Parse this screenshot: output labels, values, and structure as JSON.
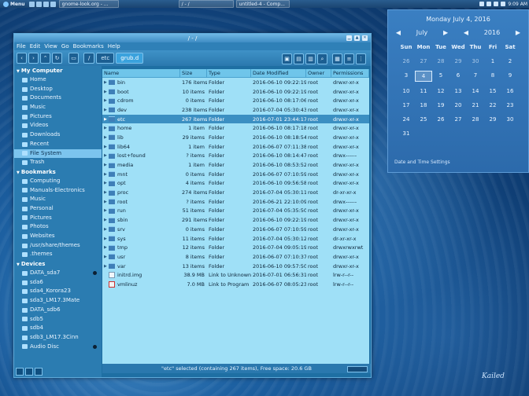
{
  "panel": {
    "menu_label": "Menu",
    "tasks": [
      "gnome-look.org - ...",
      "/ - /",
      "untitled-4 - Comp..."
    ],
    "clock": "9:09 AM"
  },
  "calendar": {
    "date_title": "Monday July  4, 2016",
    "month": "July",
    "year": "2016",
    "prev_arrow": "◀",
    "next_arrow": "▶",
    "weekdays": [
      "Sun",
      "Mon",
      "Tue",
      "Wed",
      "Thu",
      "Fri",
      "Sat"
    ],
    "weeks": [
      [
        "26",
        "27",
        "28",
        "29",
        "30",
        "1",
        "2"
      ],
      [
        "3",
        "4",
        "5",
        "6",
        "7",
        "8",
        "9"
      ],
      [
        "10",
        "11",
        "12",
        "13",
        "14",
        "15",
        "16"
      ],
      [
        "17",
        "18",
        "19",
        "20",
        "21",
        "22",
        "23"
      ],
      [
        "24",
        "25",
        "26",
        "27",
        "28",
        "29",
        "30"
      ],
      [
        "31",
        "",
        "",
        "",
        "",
        "",
        ""
      ]
    ],
    "today": "4",
    "footer": "Date and Time Settings"
  },
  "window": {
    "title": "/ - /",
    "menu": [
      "File",
      "Edit",
      "View",
      "Go",
      "Bookmarks",
      "Help"
    ],
    "breadcrumbs": [
      "/",
      "etc",
      "grub.d"
    ],
    "columns": {
      "name": "Name",
      "size": "Size",
      "type": "Type",
      "modified": "Date Modified",
      "owner": "Owner",
      "perms": "Permissions"
    },
    "files": [
      {
        "name": "bin",
        "size": "176 items",
        "type": "Folder",
        "modified": "2016-06-10 09:22:19",
        "owner": "root",
        "perms": "drwxr-xr-x",
        "icon": "folder"
      },
      {
        "name": "boot",
        "size": "10 items",
        "type": "Folder",
        "modified": "2016-06-10 09:22:19",
        "owner": "root",
        "perms": "drwxr-xr-x",
        "icon": "folder"
      },
      {
        "name": "cdrom",
        "size": "0 items",
        "type": "Folder",
        "modified": "2016-06-10 08:17:06",
        "owner": "root",
        "perms": "drwxr-xr-x",
        "icon": "folder"
      },
      {
        "name": "dev",
        "size": "238 items",
        "type": "Folder",
        "modified": "2016-07-04 05:30:43",
        "owner": "root",
        "perms": "drwxr-xr-x",
        "icon": "folder"
      },
      {
        "name": "etc",
        "size": "267 items",
        "type": "Folder",
        "modified": "2016-07-01 23:44:17",
        "owner": "root",
        "perms": "drwxr-xr-x",
        "icon": "folder",
        "selected": true
      },
      {
        "name": "home",
        "size": "1 item",
        "type": "Folder",
        "modified": "2016-06-10 08:17:18",
        "owner": "root",
        "perms": "drwxr-xr-x",
        "icon": "folder"
      },
      {
        "name": "lib",
        "size": "29 items",
        "type": "Folder",
        "modified": "2016-06-10 08:18:54",
        "owner": "root",
        "perms": "drwxr-xr-x",
        "icon": "folder"
      },
      {
        "name": "lib64",
        "size": "1 item",
        "type": "Folder",
        "modified": "2016-06-07 07:11:38",
        "owner": "root",
        "perms": "drwxr-xr-x",
        "icon": "folder"
      },
      {
        "name": "lost+found",
        "size": "? items",
        "type": "Folder",
        "modified": "2016-06-10 08:14:47",
        "owner": "root",
        "perms": "drwx------",
        "icon": "folder"
      },
      {
        "name": "media",
        "size": "1 item",
        "type": "Folder",
        "modified": "2016-06-10 08:53:52",
        "owner": "root",
        "perms": "drwxr-xr-x",
        "icon": "folder"
      },
      {
        "name": "mnt",
        "size": "0 items",
        "type": "Folder",
        "modified": "2016-06-07 07:10:59",
        "owner": "root",
        "perms": "drwxr-xr-x",
        "icon": "folder"
      },
      {
        "name": "opt",
        "size": "4 items",
        "type": "Folder",
        "modified": "2016-06-10 09:56:58",
        "owner": "root",
        "perms": "drwxr-xr-x",
        "icon": "folder"
      },
      {
        "name": "proc",
        "size": "274 items",
        "type": "Folder",
        "modified": "2016-07-04 05:30:11",
        "owner": "root",
        "perms": "dr-xr-xr-x",
        "icon": "folder"
      },
      {
        "name": "root",
        "size": "? items",
        "type": "Folder",
        "modified": "2016-06-21 22:10:09",
        "owner": "root",
        "perms": "drwx------",
        "icon": "folder"
      },
      {
        "name": "run",
        "size": "51 items",
        "type": "Folder",
        "modified": "2016-07-04 05:35:50",
        "owner": "root",
        "perms": "drwxr-xr-x",
        "icon": "folder"
      },
      {
        "name": "sbin",
        "size": "291 items",
        "type": "Folder",
        "modified": "2016-06-10 09:22:19",
        "owner": "root",
        "perms": "drwxr-xr-x",
        "icon": "folder"
      },
      {
        "name": "srv",
        "size": "0 items",
        "type": "Folder",
        "modified": "2016-06-07 07:10:59",
        "owner": "root",
        "perms": "drwxr-xr-x",
        "icon": "folder"
      },
      {
        "name": "sys",
        "size": "11 items",
        "type": "Folder",
        "modified": "2016-07-04 05:30:12",
        "owner": "root",
        "perms": "dr-xr-xr-x",
        "icon": "folder"
      },
      {
        "name": "tmp",
        "size": "12 items",
        "type": "Folder",
        "modified": "2016-07-04 09:05:19",
        "owner": "root",
        "perms": "drwxrwxrwt",
        "icon": "folder"
      },
      {
        "name": "usr",
        "size": "8 items",
        "type": "Folder",
        "modified": "2016-06-07 07:10:37",
        "owner": "root",
        "perms": "drwxr-xr-x",
        "icon": "folder"
      },
      {
        "name": "var",
        "size": "13 items",
        "type": "Folder",
        "modified": "2016-06-10 09:57:50",
        "owner": "root",
        "perms": "drwxr-xr-x",
        "icon": "folder"
      },
      {
        "name": "initrd.img",
        "size": "38.9 MB",
        "type": "Link to Unknown",
        "modified": "2016-07-01 06:56:31",
        "owner": "root",
        "perms": "lrw-r--r--",
        "icon": "file"
      },
      {
        "name": "vmlinuz",
        "size": "7.0 MB",
        "type": "Link to Program",
        "modified": "2016-06-07 08:05:23",
        "owner": "root",
        "perms": "lrw-r--r--",
        "icon": "link"
      }
    ],
    "status": "\"etc\" selected (containing 267 items), Free space: 20.6 GB"
  },
  "sidebar": {
    "sections": [
      {
        "title": "My Computer",
        "items": [
          {
            "label": "Home",
            "icon": "home-icon"
          },
          {
            "label": "Desktop",
            "icon": "desktop-icon"
          },
          {
            "label": "Documents",
            "icon": "folder-icon"
          },
          {
            "label": "Music",
            "icon": "folder-icon"
          },
          {
            "label": "Pictures",
            "icon": "folder-icon"
          },
          {
            "label": "Videos",
            "icon": "folder-icon"
          },
          {
            "label": "Downloads",
            "icon": "folder-icon"
          },
          {
            "label": "Recent",
            "icon": "recent-icon"
          },
          {
            "label": "File System",
            "icon": "drive-icon",
            "selected": true
          },
          {
            "label": "Trash",
            "icon": "trash-icon"
          }
        ]
      },
      {
        "title": "Bookmarks",
        "items": [
          {
            "label": "Computing",
            "icon": "folder-icon"
          },
          {
            "label": "Manuals-Electronics",
            "icon": "folder-icon"
          },
          {
            "label": "Music",
            "icon": "folder-icon"
          },
          {
            "label": "Personal",
            "icon": "folder-icon"
          },
          {
            "label": "Pictures",
            "icon": "folder-icon"
          },
          {
            "label": "Photos",
            "icon": "folder-icon"
          },
          {
            "label": "Websites",
            "icon": "folder-icon"
          },
          {
            "label": "/usr/share/themes",
            "icon": "folder-icon"
          },
          {
            "label": ".themes",
            "icon": "folder-icon"
          }
        ]
      },
      {
        "title": "Devices",
        "items": [
          {
            "label": "DATA_sda7",
            "icon": "drive-icon",
            "eject": true
          },
          {
            "label": "sda6",
            "icon": "drive-icon"
          },
          {
            "label": "sda4_Korora23",
            "icon": "drive-icon"
          },
          {
            "label": "sda3_LM17.3Mate",
            "icon": "drive-icon"
          },
          {
            "label": "DATA_sdb6",
            "icon": "drive-icon"
          },
          {
            "label": "sdb5",
            "icon": "drive-icon"
          },
          {
            "label": "sdb4",
            "icon": "drive-icon"
          },
          {
            "label": "sdb3_LM17.3Cinn",
            "icon": "drive-icon"
          },
          {
            "label": "Audio Disc",
            "icon": "disc-icon",
            "eject": true
          }
        ]
      }
    ]
  },
  "signature": "Kailed"
}
